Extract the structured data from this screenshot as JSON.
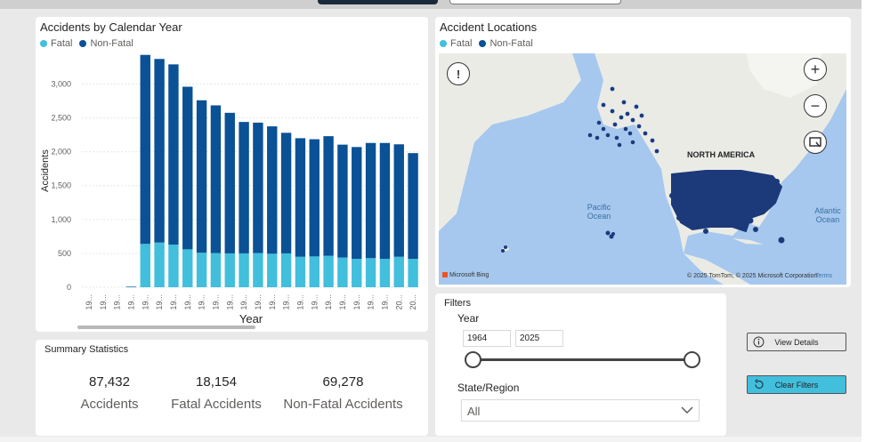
{
  "chart": {
    "title": "Accidents by Calendar Year",
    "legend": [
      {
        "label": "Fatal",
        "color": "#41bfdc"
      },
      {
        "label": "Non-Fatal",
        "color": "#0a5196"
      }
    ],
    "y_ticks": [
      "3,000",
      "2,500",
      "2,000",
      "1,500",
      "1,000",
      "500",
      "0"
    ],
    "y_axis_label": "Accidents",
    "x_axis_label": "Year",
    "x_tick_labels": [
      "19...",
      "19...",
      "19...",
      "19...",
      "19...",
      "19...",
      "19...",
      "19...",
      "19...",
      "19...",
      "19...",
      "19...",
      "19...",
      "19...",
      "19...",
      "19...",
      "19...",
      "19...",
      "19...",
      "19...",
      "19...",
      "19...",
      "20...",
      "20..."
    ]
  },
  "chart_data": {
    "type": "bar",
    "stacked": true,
    "title": "Accidents by Calendar Year",
    "xlabel": "Year",
    "ylabel": "Accidents",
    "ylim": [
      0,
      3400
    ],
    "grid": true,
    "legend_position": "top-left",
    "series": [
      {
        "name": "Fatal",
        "color": "#41bfdc",
        "values": [
          0,
          0,
          0,
          5,
          640,
          660,
          630,
          560,
          510,
          505,
          500,
          500,
          505,
          495,
          500,
          450,
          455,
          465,
          440,
          420,
          430,
          420,
          450,
          420
        ]
      },
      {
        "name": "Non-Fatal",
        "color": "#0a5196",
        "values": [
          0,
          0,
          0,
          5,
          2790,
          2710,
          2660,
          2400,
          2250,
          2180,
          2075,
          1940,
          1925,
          1880,
          1780,
          1750,
          1730,
          1765,
          1665,
          1650,
          1700,
          1710,
          1660,
          1560
        ]
      }
    ]
  },
  "map": {
    "title": "Accident Locations",
    "legend": [
      {
        "label": "Fatal",
        "color": "#41bfdc"
      },
      {
        "label": "Non-Fatal",
        "color": "#0a5196"
      }
    ],
    "labels": {
      "north_america": "NORTH AMERICA",
      "pacific_line1": "Pacific",
      "pacific_line2": "Ocean",
      "atlantic_line1": "Atlantic",
      "atlantic_line2": "Ocean"
    },
    "bing": "Microsoft Bing",
    "copyright": "© 2025 TomTom, © 2025 Microsoft Corporation",
    "terms": "Terms"
  },
  "summary": {
    "title": "Summary Statistics",
    "stats": [
      {
        "value": "87,432",
        "label": "Accidents"
      },
      {
        "value": "18,154",
        "label": "Fatal Accidents"
      },
      {
        "value": "69,278",
        "label": "Non-Fatal Accidents"
      }
    ]
  },
  "filters": {
    "title": "Filters",
    "year_label": "Year",
    "year_min": "1964",
    "year_max": "2025",
    "state_label": "State/Region",
    "state_value": "All"
  },
  "buttons": {
    "view_details": "View Details",
    "clear_filters": "Clear Filters",
    "clear_color": "#41bfdc"
  }
}
